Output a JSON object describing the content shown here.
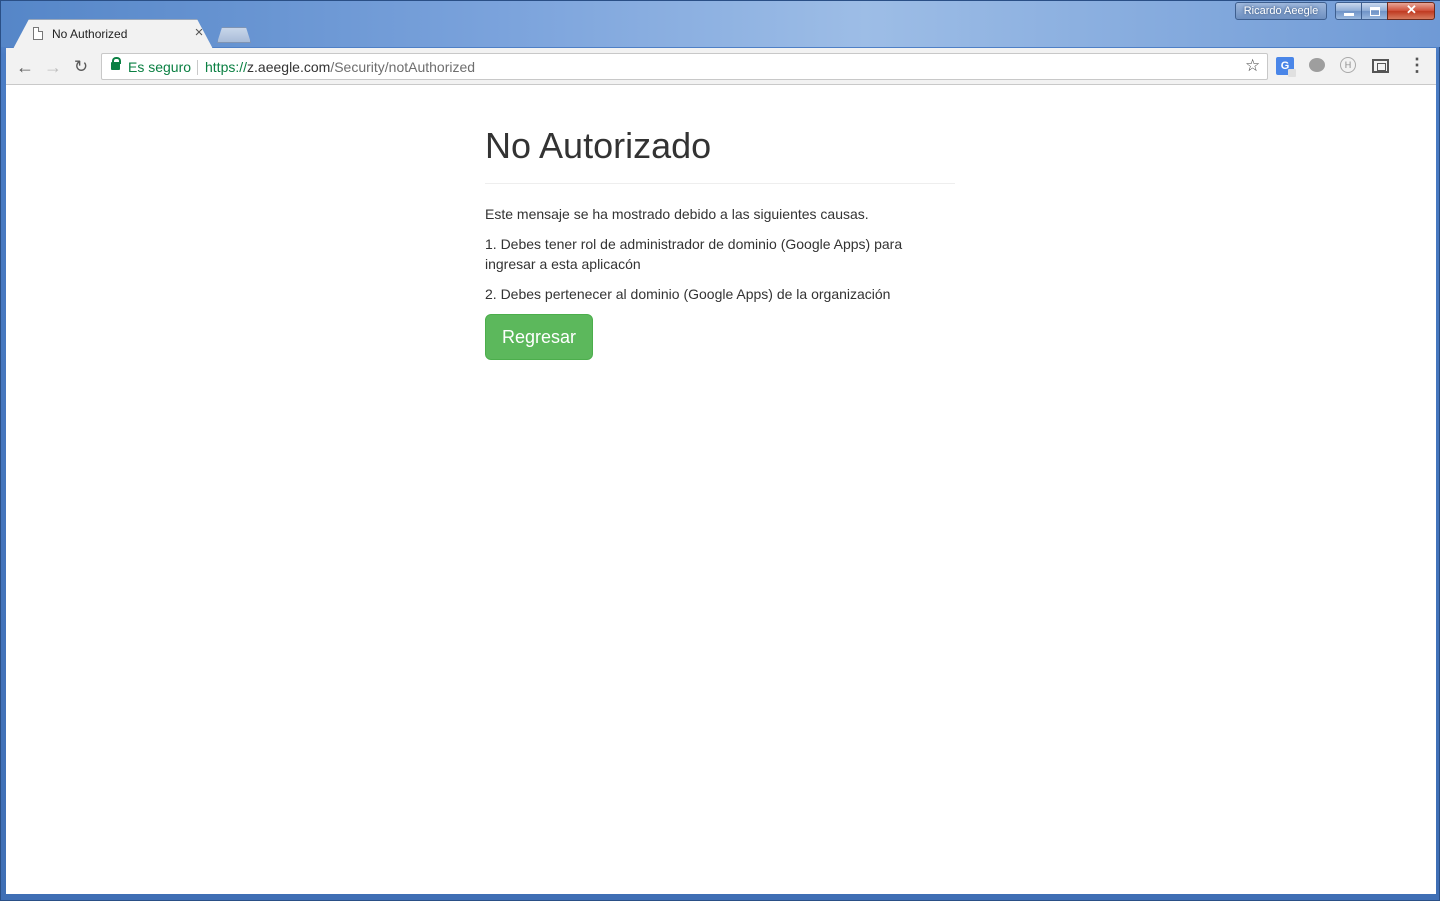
{
  "window": {
    "profile_name": "Ricardo Aeegle",
    "close_glyph": "✕"
  },
  "tabs": [
    {
      "title": "No Authorized",
      "close_glyph": "×"
    }
  ],
  "toolbar": {
    "back_glyph": "←",
    "forward_glyph": "→",
    "reload_glyph": "↻",
    "secure_label": "Es seguro",
    "url_scheme": "https://",
    "url_host": "z.aeegle.com",
    "url_path": "/Security/notAuthorized",
    "star_glyph": "☆",
    "translate_glyph": "G",
    "hex_glyph": "H",
    "menu_glyph": "⋮"
  },
  "page": {
    "title": "No Autorizado",
    "intro": "Este mensaje se ha mostrado debido a las siguientes causas.",
    "reason_1": "1. Debes tener rol de administrador de dominio (Google Apps) para ingresar a esta aplicacón",
    "reason_2": "2. Debes pertenecer al dominio (Google Apps) de la organización",
    "back_button_label": "Regresar",
    "button_color": "#5cb85c"
  }
}
